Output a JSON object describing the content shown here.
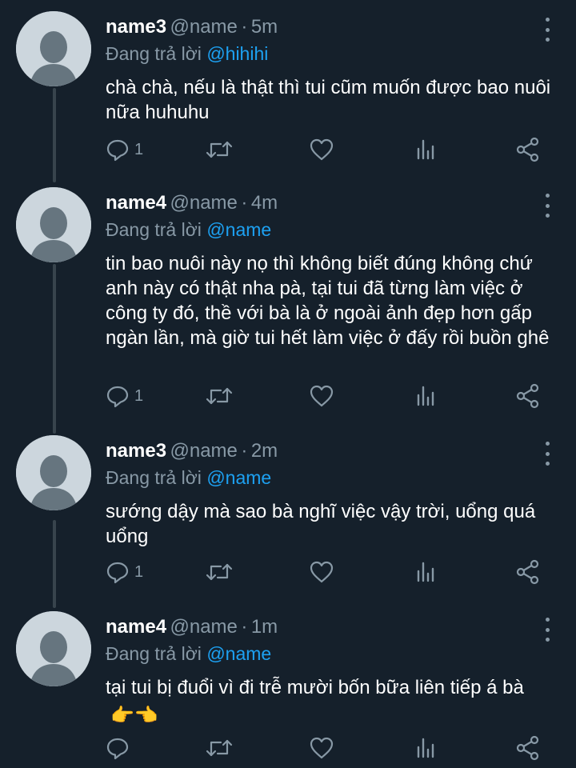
{
  "colors": {
    "background": "#15202b",
    "secondary_text": "#8899a6",
    "mention": "#1da1f2",
    "thread_line": "#38444d",
    "avatar": "#ccd6dd"
  },
  "tweets": [
    {
      "name": "name3",
      "handle": "@name",
      "separator": "·",
      "time": "5m",
      "replying_label": "Đang trả lời",
      "replying_to": "@hihihi",
      "text": "chà chà, nếu là thật thì tui cũm muốn được bao nuôi nữa huhuhu",
      "reply_count": "1"
    },
    {
      "name": "name4",
      "handle": "@name",
      "separator": "·",
      "time": "4m",
      "replying_label": "Đang trả lời",
      "replying_to": "@name",
      "text": "tin bao nuôi này nọ thì không biết đúng không chứ anh này có thật nha pà, tại tui đã từng làm việc ở công ty đó, thề với bà là ở ngoài ảnh đẹp hơn gấp ngàn lần, mà giờ tui hết làm việc ở đấy rồi buồn ghê",
      "reply_count": "1"
    },
    {
      "name": "name3",
      "handle": "@name",
      "separator": "·",
      "time": "2m",
      "replying_label": "Đang trả lời",
      "replying_to": "@name",
      "text": "sướng dậy mà sao bà nghĩ việc vậy trời, uổng quá uổng",
      "reply_count": "1"
    },
    {
      "name": "name4",
      "handle": "@name",
      "separator": "·",
      "time": "1m",
      "replying_label": "Đang trả lời",
      "replying_to": "@name",
      "text": "tại tui bị đuổi vì đi trễ mười bốn bữa liên tiếp á bà",
      "text_emoji": "👉👈",
      "reply_count": ""
    }
  ],
  "icons": [
    "reply-icon",
    "retweet-icon",
    "like-icon",
    "analytics-icon",
    "share-icon",
    "more-icon",
    "avatar-placeholder"
  ]
}
